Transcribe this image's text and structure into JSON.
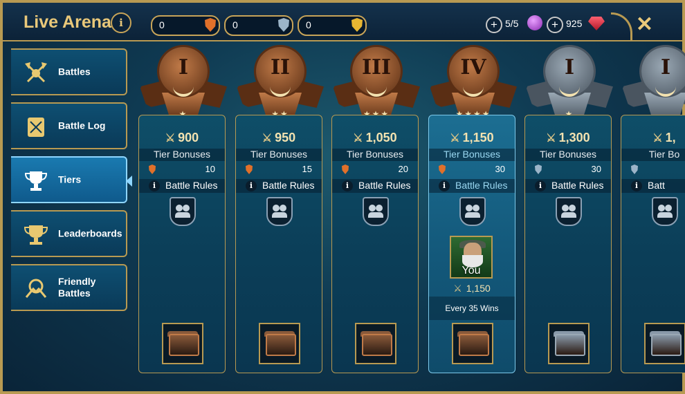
{
  "header": {
    "title": "Live Arena",
    "tokens": [
      {
        "value": "0",
        "color": "#e0702a",
        "icon": "bronze-medal-icon"
      },
      {
        "value": "0",
        "color": "#9bb4c8",
        "icon": "silver-medal-icon"
      },
      {
        "value": "0",
        "color": "#e8b632",
        "icon": "gold-medal-icon"
      }
    ],
    "resources": [
      {
        "value": "5/5",
        "icon": "arena-token-gem-icon",
        "color": "#b04ad0"
      },
      {
        "value": "925",
        "icon": "ruby-icon",
        "color": "#e03040"
      }
    ]
  },
  "sidebar": {
    "items": [
      {
        "label": "Battles",
        "icon": "crossed-axes-icon",
        "active": false
      },
      {
        "label": "Battle Log",
        "icon": "scroll-icon",
        "active": false
      },
      {
        "label": "Tiers",
        "icon": "trophy-icon",
        "active": true
      },
      {
        "label": "Leaderboards",
        "icon": "double-trophy-icon",
        "active": false
      },
      {
        "label": "Friendly Battles",
        "icon": "handshake-icon",
        "active": false
      }
    ]
  },
  "tiers": [
    {
      "numeral": "I",
      "stars": "★",
      "rating": "900",
      "tier_bonuses": "Tier Bonuses",
      "bonus": "10",
      "battle_rules": "Battle Rules",
      "metal": "bronze",
      "current": false
    },
    {
      "numeral": "II",
      "stars": "★★",
      "rating": "950",
      "tier_bonuses": "Tier Bonuses",
      "bonus": "15",
      "battle_rules": "Battle Rules",
      "metal": "bronze",
      "current": false
    },
    {
      "numeral": "III",
      "stars": "★★★",
      "rating": "1,050",
      "tier_bonuses": "Tier Bonuses",
      "bonus": "20",
      "battle_rules": "Battle Rules",
      "metal": "bronze",
      "current": false
    },
    {
      "numeral": "IV",
      "stars": "★★★★",
      "rating": "1,150",
      "tier_bonuses": "Tier Bonuses",
      "bonus": "30",
      "battle_rules": "Battle Rules",
      "metal": "bronze",
      "current": true
    },
    {
      "numeral": "I",
      "stars": "★",
      "rating": "1,300",
      "tier_bonuses": "Tier Bonuses",
      "bonus": "30",
      "battle_rules": "Battle Rules",
      "metal": "silver",
      "current": false
    },
    {
      "numeral": "I",
      "stars": "",
      "rating": "1,",
      "tier_bonuses": "Tier Bo",
      "bonus": "",
      "battle_rules": "Batt",
      "metal": "silver",
      "current": false
    }
  ],
  "player": {
    "label": "You",
    "rating": "1,150",
    "reward_note": "Every 35 Wins"
  },
  "colors": {
    "gold_border": "#b89a52",
    "bronze": "#c07a48",
    "silver": "#9aa8b4",
    "bonus_bronze": "#e0702a",
    "bonus_silver": "#9bb4c8"
  }
}
